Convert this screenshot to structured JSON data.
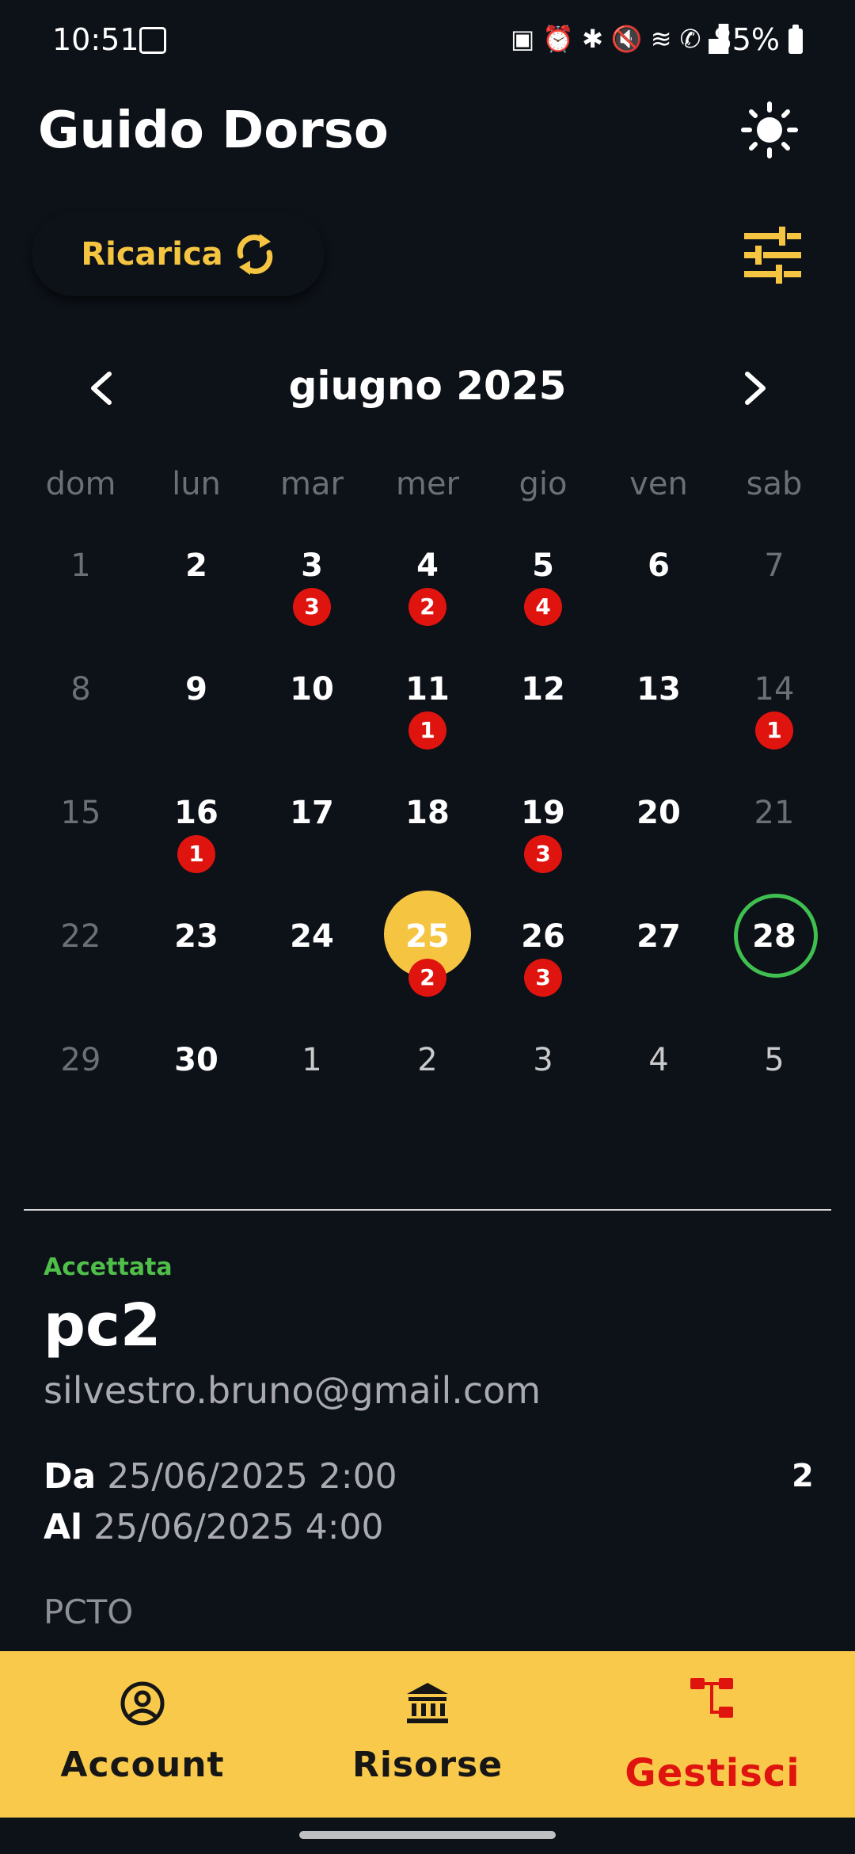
{
  "status_bar": {
    "time": "10:51",
    "battery": "85%"
  },
  "header": {
    "title": "Guido Dorso"
  },
  "toolbar": {
    "reload_label": "Ricarica"
  },
  "calendar": {
    "month_label": "giugno 2025",
    "weekdays": [
      "dom",
      "lun",
      "mar",
      "mer",
      "gio",
      "ven",
      "sab"
    ],
    "weeks": [
      [
        {
          "d": "1",
          "s": "muted"
        },
        {
          "d": "2",
          "s": "normal"
        },
        {
          "d": "3",
          "s": "normal",
          "b": "3"
        },
        {
          "d": "4",
          "s": "normal",
          "b": "2"
        },
        {
          "d": "5",
          "s": "normal",
          "b": "4"
        },
        {
          "d": "6",
          "s": "normal"
        },
        {
          "d": "7",
          "s": "muted"
        }
      ],
      [
        {
          "d": "8",
          "s": "muted"
        },
        {
          "d": "9",
          "s": "normal"
        },
        {
          "d": "10",
          "s": "normal"
        },
        {
          "d": "11",
          "s": "normal",
          "b": "1"
        },
        {
          "d": "12",
          "s": "normal"
        },
        {
          "d": "13",
          "s": "normal"
        },
        {
          "d": "14",
          "s": "muted",
          "b": "1"
        }
      ],
      [
        {
          "d": "15",
          "s": "muted"
        },
        {
          "d": "16",
          "s": "normal",
          "b": "1"
        },
        {
          "d": "17",
          "s": "normal"
        },
        {
          "d": "18",
          "s": "normal"
        },
        {
          "d": "19",
          "s": "normal",
          "b": "3"
        },
        {
          "d": "20",
          "s": "normal"
        },
        {
          "d": "21",
          "s": "muted"
        }
      ],
      [
        {
          "d": "22",
          "s": "muted"
        },
        {
          "d": "23",
          "s": "normal"
        },
        {
          "d": "24",
          "s": "normal"
        },
        {
          "d": "25",
          "s": "today",
          "b": "2"
        },
        {
          "d": "26",
          "s": "normal",
          "b": "3"
        },
        {
          "d": "27",
          "s": "normal"
        },
        {
          "d": "28",
          "s": "selected"
        }
      ],
      [
        {
          "d": "29",
          "s": "muted"
        },
        {
          "d": "30",
          "s": "normal"
        },
        {
          "d": "1",
          "s": "out"
        },
        {
          "d": "2",
          "s": "out"
        },
        {
          "d": "3",
          "s": "out"
        },
        {
          "d": "4",
          "s": "out"
        },
        {
          "d": "5",
          "s": "out"
        }
      ]
    ]
  },
  "booking": {
    "status": "Accettata",
    "resource": "pc2",
    "email": "silvestro.bruno@gmail.com",
    "from_label": "Da",
    "from_value": "25/06/2025 2:00",
    "to_label": "Al",
    "to_value": "25/06/2025 4:00",
    "count": "2",
    "reason": "PCTO"
  },
  "bottom_nav": {
    "account": "Account",
    "resources": "Risorse",
    "manage": "Gestisci"
  },
  "colors": {
    "background": "#0d1118",
    "accent": "#f5c542",
    "badge": "#e0140f",
    "accepted": "#4fbf4a",
    "nav_bar": "#f8c94b"
  }
}
